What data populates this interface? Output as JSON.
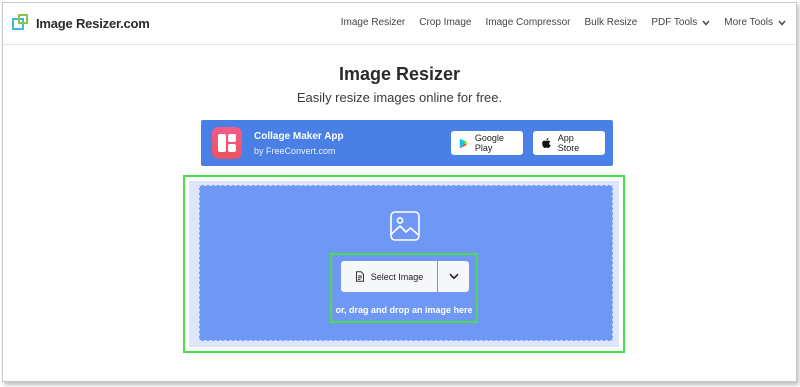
{
  "header": {
    "logo_text": "Image Resizer.com",
    "nav": [
      {
        "label": "Image Resizer"
      },
      {
        "label": "Crop Image"
      },
      {
        "label": "Image Compressor"
      },
      {
        "label": "Bulk Resize"
      },
      {
        "label": "PDF Tools",
        "has_dropdown": true
      },
      {
        "label": "More Tools",
        "has_dropdown": true
      }
    ]
  },
  "hero": {
    "title": "Image Resizer",
    "subtitle": "Easily resize images online for free."
  },
  "banner": {
    "app_title": "Collage Maker App",
    "app_sub": "by FreeConvert.com",
    "google_label": "Google Play",
    "apple_label": "App Store",
    "background_color": "#4a7fe6"
  },
  "upload": {
    "select_label": "Select Image",
    "drag_text": "or, drag and drop an image here",
    "zone_color": "#6e98f3",
    "highlight_color": "#4cdb4c"
  }
}
